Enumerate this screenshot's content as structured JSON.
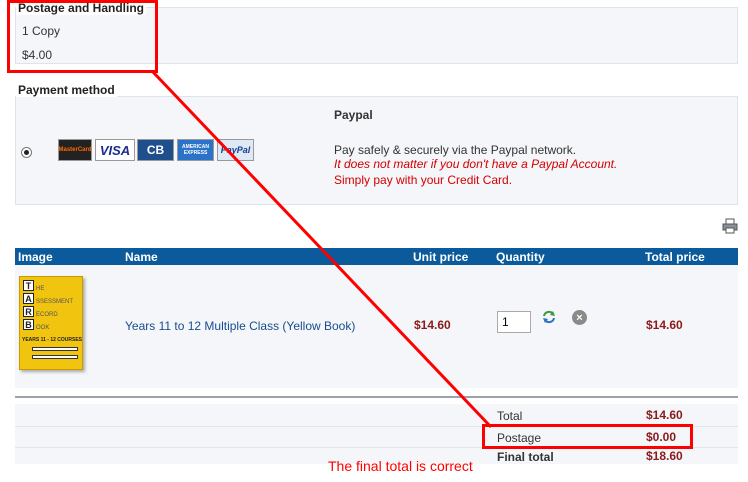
{
  "postage": {
    "title": "Postage and Handling",
    "copies": "1 Copy",
    "amount": "$4.00"
  },
  "payment": {
    "title": "Payment method",
    "option_name": "Paypal",
    "line1": "Pay safely & securely via the Paypal network.",
    "line2": "It does not matter if you don't have a Paypal Account.",
    "line3": "Simply pay with your Credit Card.",
    "cards": [
      "MasterCard",
      "VISA",
      "CB",
      "AMERICAN EXPRESS",
      "PayPal"
    ]
  },
  "cart": {
    "columns": [
      "Image",
      "Name",
      "Unit price",
      "Quantity",
      "Total price"
    ],
    "item": {
      "name": "Years 11 to 12 Multiple Class (Yellow Book)",
      "unit_price": "$14.60",
      "quantity": "1",
      "total_price": "$14.60",
      "cover": {
        "letters": [
          "T",
          "A",
          "R",
          "B"
        ],
        "words": [
          "HE",
          "SSESSMENT",
          "ECORD",
          "OOK"
        ],
        "caption": "YEARS 11 - 12 COURSES"
      }
    },
    "totals": {
      "total_label": "Total",
      "total_value": "$14.60",
      "postage_label": "Postage",
      "postage_value": "$0.00",
      "final_label": "Final total",
      "final_value": "$18.60"
    }
  },
  "annotation": {
    "text": "The final total is correct",
    "color": "#ff0000"
  }
}
